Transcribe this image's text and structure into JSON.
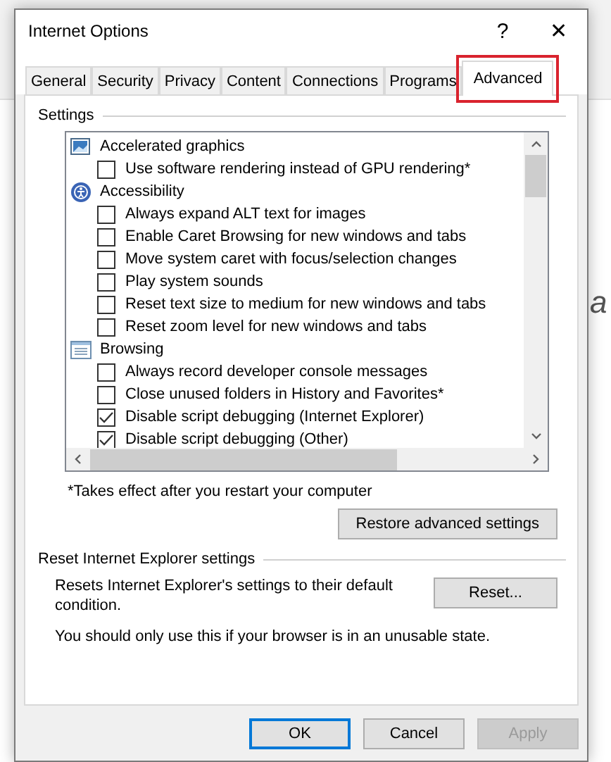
{
  "backdrop": {
    "text": "a"
  },
  "window": {
    "title": "Internet Options",
    "help": "?",
    "close": "✕"
  },
  "tabs": [
    {
      "label": "General",
      "selected": false,
      "highlighted": false
    },
    {
      "label": "Security",
      "selected": false,
      "highlighted": false
    },
    {
      "label": "Privacy",
      "selected": false,
      "highlighted": false
    },
    {
      "label": "Content",
      "selected": false,
      "highlighted": false
    },
    {
      "label": "Connections",
      "selected": false,
      "highlighted": false
    },
    {
      "label": "Programs",
      "selected": false,
      "highlighted": false
    },
    {
      "label": "Advanced",
      "selected": true,
      "highlighted": true
    }
  ],
  "settings": {
    "legend": "Settings",
    "items": [
      {
        "kind": "group",
        "label": "Accelerated graphics"
      },
      {
        "kind": "checkbox",
        "label": "Use software rendering instead of GPU rendering*",
        "checked": false
      },
      {
        "kind": "group",
        "label": "Accessibility"
      },
      {
        "kind": "checkbox",
        "label": "Always expand ALT text for images",
        "checked": false
      },
      {
        "kind": "checkbox",
        "label": "Enable Caret Browsing for new windows and tabs",
        "checked": false
      },
      {
        "kind": "checkbox",
        "label": "Move system caret with focus/selection changes",
        "checked": false
      },
      {
        "kind": "checkbox",
        "label": "Play system sounds",
        "checked": false
      },
      {
        "kind": "checkbox",
        "label": "Reset text size to medium for new windows and tabs",
        "checked": false
      },
      {
        "kind": "checkbox",
        "label": "Reset zoom level for new windows and tabs",
        "checked": false
      },
      {
        "kind": "group",
        "label": "Browsing"
      },
      {
        "kind": "checkbox",
        "label": "Always record developer console messages",
        "checked": false
      },
      {
        "kind": "checkbox",
        "label": "Close unused folders in History and Favorites*",
        "checked": false
      },
      {
        "kind": "checkbox",
        "label": "Disable script debugging (Internet Explorer)",
        "checked": true
      },
      {
        "kind": "checkbox",
        "label": "Disable script debugging (Other)",
        "checked": true
      }
    ],
    "note": "*Takes effect after you restart your computer",
    "restore_button": "Restore advanced settings"
  },
  "reset": {
    "legend": "Reset Internet Explorer settings",
    "description": "Resets Internet Explorer's settings to their default condition.",
    "button": "Reset...",
    "warning": "You should only use this if your browser is in an unusable state."
  },
  "buttons": [
    {
      "label": "OK",
      "default": true,
      "disabled": false
    },
    {
      "label": "Cancel",
      "default": false,
      "disabled": false
    },
    {
      "label": "Apply",
      "default": false,
      "disabled": true
    }
  ]
}
